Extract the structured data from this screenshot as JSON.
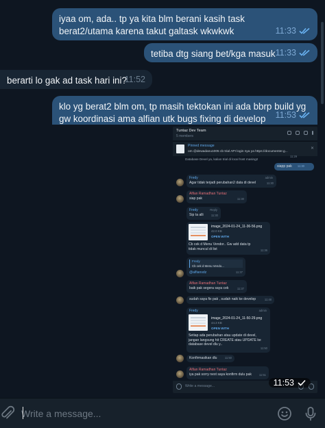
{
  "messages": [
    {
      "dir": "out",
      "text": "iyaa om, ada.. tp ya kita blm berani kasih task berat2/utama karena takut galtask wkwkwk",
      "time": "11:33",
      "status": "read"
    },
    {
      "dir": "out",
      "text": "tetiba dtg siang bet/kga masuk",
      "time": "11:33",
      "status": "read"
    },
    {
      "dir": "in",
      "text": "berarti lo gak ad task hari ini?",
      "time": "11:52"
    },
    {
      "dir": "out",
      "text": "klo yg berat2 blm om, tp masih tektokan ini ada bbrp build yg gw koordinasi ama alfian utk bugs fixing di develop",
      "time": "11:53",
      "status": "read"
    }
  ],
  "screenshot_message": {
    "time": "11:53",
    "group_title": "Tuntaz Dev Team",
    "group_members": "5 members",
    "pinned_label": "Pinned message",
    "pinned_text": "om @dewadanu1005 cb trial API login nya ya https://documenter.g...",
    "peek_text": "Database Devel ya, kalian trial di local host masing2",
    "peek_time": "11:29",
    "items": {
      "siap_out": {
        "text": "siapp pak",
        "time": "11:30"
      },
      "fredy1": {
        "sender": "Fredy",
        "role": "admin",
        "text": "Agar tidak terjadi perubahan2 data di devel",
        "time": "11:30"
      },
      "alfian1": {
        "sender": "Alfian Ramadhan Tuntaz",
        "text": "siap pak",
        "time": "11:30"
      },
      "fredy2": {
        "sender": "Fredy",
        "reply_label": "Reply",
        "text": "Sip ta alli",
        "time": "11:30"
      },
      "file1": {
        "name": "image_2024-01-24_11-36-56.png",
        "size": "42.0 KB",
        "open": "OPEN WITH",
        "caption": "Cb cek d Menu Vendor.. Gw add data tp tidak muncul di list",
        "time": "11:36"
      },
      "reply1": {
        "sender": "Fredy",
        "quote": "Cb cek d Menu Vendo...",
        "text": "@alfiansdz",
        "time": "11:37"
      },
      "alfian2": {
        "sender": "Alfian Ramadhan Tuntaz",
        "text": "baik pak segera saya cek",
        "time": "11:37"
      },
      "alfian3": {
        "text": "sudah saya fix pak , sudah naik ke develop",
        "time": "11:48"
      },
      "fredy3": {
        "sender": "Fredy",
        "role": "admin",
        "name": "image_2024-01-24_11-50-29.png",
        "size": "44.3 KB",
        "open": "OPEN WITH",
        "caption": "Setiap ada perubahan atau update di devel, jangan langsung hit CREATE atau UPDATE ke database devel dlu y..",
        "time": "11:50"
      },
      "fredy4": {
        "text": "Konfirmasikan dlu",
        "time": "11:50"
      },
      "alfian4": {
        "sender": "Alfian Ramadhan Tuntaz",
        "text": "iya pak sorry next saya konfirm dulu pak",
        "time": "11:51"
      }
    },
    "input_placeholder": "Write a message..."
  },
  "composer": {
    "placeholder": "Write a message...",
    "attach_icon": "paperclip-icon",
    "emoji_icon": "emoji-icon",
    "mic_icon": "microphone-icon"
  },
  "colors": {
    "background": "#0e1621",
    "bubble_out": "#2b5278",
    "bubble_in": "#182533",
    "accent": "#5ea6e8",
    "composer": "#17212b"
  }
}
